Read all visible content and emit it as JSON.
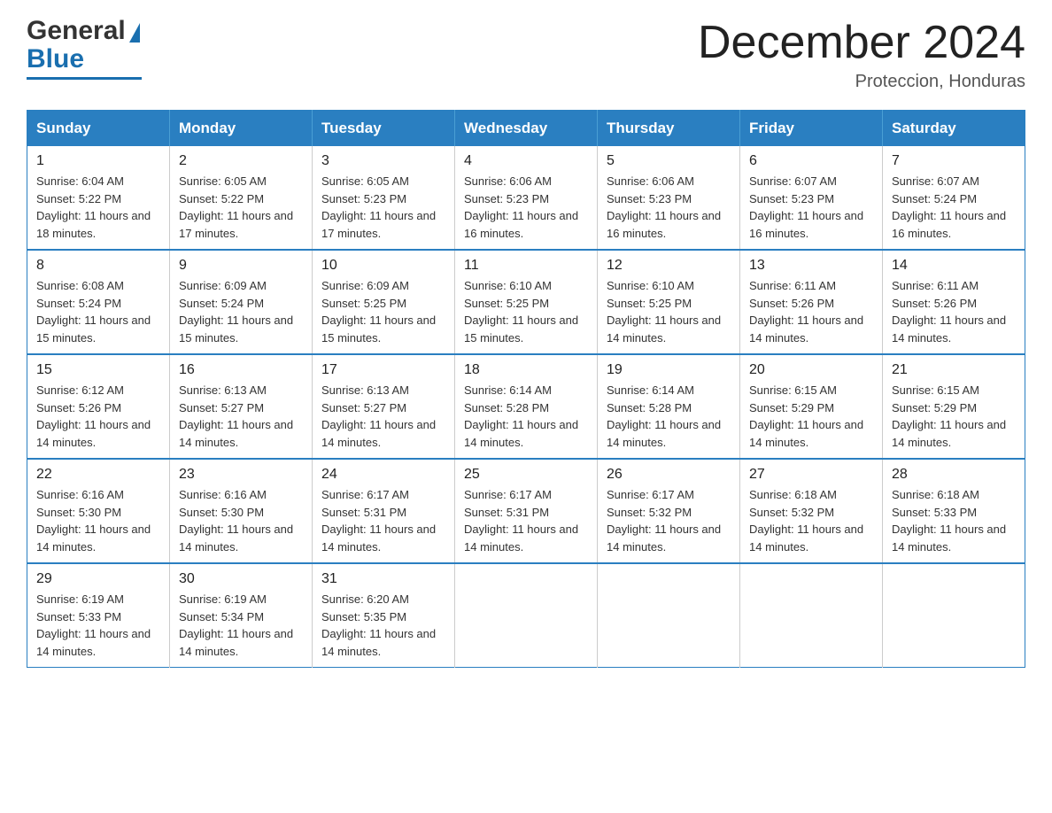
{
  "logo": {
    "general": "General",
    "blue": "Blue",
    "triangle": "▶"
  },
  "title": {
    "month_year": "December 2024",
    "location": "Proteccion, Honduras"
  },
  "weekdays": [
    "Sunday",
    "Monday",
    "Tuesday",
    "Wednesday",
    "Thursday",
    "Friday",
    "Saturday"
  ],
  "weeks": [
    [
      {
        "day": "1",
        "sunrise": "6:04 AM",
        "sunset": "5:22 PM",
        "daylight": "11 hours and 18 minutes."
      },
      {
        "day": "2",
        "sunrise": "6:05 AM",
        "sunset": "5:22 PM",
        "daylight": "11 hours and 17 minutes."
      },
      {
        "day": "3",
        "sunrise": "6:05 AM",
        "sunset": "5:23 PM",
        "daylight": "11 hours and 17 minutes."
      },
      {
        "day": "4",
        "sunrise": "6:06 AM",
        "sunset": "5:23 PM",
        "daylight": "11 hours and 16 minutes."
      },
      {
        "day": "5",
        "sunrise": "6:06 AM",
        "sunset": "5:23 PM",
        "daylight": "11 hours and 16 minutes."
      },
      {
        "day": "6",
        "sunrise": "6:07 AM",
        "sunset": "5:23 PM",
        "daylight": "11 hours and 16 minutes."
      },
      {
        "day": "7",
        "sunrise": "6:07 AM",
        "sunset": "5:24 PM",
        "daylight": "11 hours and 16 minutes."
      }
    ],
    [
      {
        "day": "8",
        "sunrise": "6:08 AM",
        "sunset": "5:24 PM",
        "daylight": "11 hours and 15 minutes."
      },
      {
        "day": "9",
        "sunrise": "6:09 AM",
        "sunset": "5:24 PM",
        "daylight": "11 hours and 15 minutes."
      },
      {
        "day": "10",
        "sunrise": "6:09 AM",
        "sunset": "5:25 PM",
        "daylight": "11 hours and 15 minutes."
      },
      {
        "day": "11",
        "sunrise": "6:10 AM",
        "sunset": "5:25 PM",
        "daylight": "11 hours and 15 minutes."
      },
      {
        "day": "12",
        "sunrise": "6:10 AM",
        "sunset": "5:25 PM",
        "daylight": "11 hours and 14 minutes."
      },
      {
        "day": "13",
        "sunrise": "6:11 AM",
        "sunset": "5:26 PM",
        "daylight": "11 hours and 14 minutes."
      },
      {
        "day": "14",
        "sunrise": "6:11 AM",
        "sunset": "5:26 PM",
        "daylight": "11 hours and 14 minutes."
      }
    ],
    [
      {
        "day": "15",
        "sunrise": "6:12 AM",
        "sunset": "5:26 PM",
        "daylight": "11 hours and 14 minutes."
      },
      {
        "day": "16",
        "sunrise": "6:13 AM",
        "sunset": "5:27 PM",
        "daylight": "11 hours and 14 minutes."
      },
      {
        "day": "17",
        "sunrise": "6:13 AM",
        "sunset": "5:27 PM",
        "daylight": "11 hours and 14 minutes."
      },
      {
        "day": "18",
        "sunrise": "6:14 AM",
        "sunset": "5:28 PM",
        "daylight": "11 hours and 14 minutes."
      },
      {
        "day": "19",
        "sunrise": "6:14 AM",
        "sunset": "5:28 PM",
        "daylight": "11 hours and 14 minutes."
      },
      {
        "day": "20",
        "sunrise": "6:15 AM",
        "sunset": "5:29 PM",
        "daylight": "11 hours and 14 minutes."
      },
      {
        "day": "21",
        "sunrise": "6:15 AM",
        "sunset": "5:29 PM",
        "daylight": "11 hours and 14 minutes."
      }
    ],
    [
      {
        "day": "22",
        "sunrise": "6:16 AM",
        "sunset": "5:30 PM",
        "daylight": "11 hours and 14 minutes."
      },
      {
        "day": "23",
        "sunrise": "6:16 AM",
        "sunset": "5:30 PM",
        "daylight": "11 hours and 14 minutes."
      },
      {
        "day": "24",
        "sunrise": "6:17 AM",
        "sunset": "5:31 PM",
        "daylight": "11 hours and 14 minutes."
      },
      {
        "day": "25",
        "sunrise": "6:17 AM",
        "sunset": "5:31 PM",
        "daylight": "11 hours and 14 minutes."
      },
      {
        "day": "26",
        "sunrise": "6:17 AM",
        "sunset": "5:32 PM",
        "daylight": "11 hours and 14 minutes."
      },
      {
        "day": "27",
        "sunrise": "6:18 AM",
        "sunset": "5:32 PM",
        "daylight": "11 hours and 14 minutes."
      },
      {
        "day": "28",
        "sunrise": "6:18 AM",
        "sunset": "5:33 PM",
        "daylight": "11 hours and 14 minutes."
      }
    ],
    [
      {
        "day": "29",
        "sunrise": "6:19 AM",
        "sunset": "5:33 PM",
        "daylight": "11 hours and 14 minutes."
      },
      {
        "day": "30",
        "sunrise": "6:19 AM",
        "sunset": "5:34 PM",
        "daylight": "11 hours and 14 minutes."
      },
      {
        "day": "31",
        "sunrise": "6:20 AM",
        "sunset": "5:35 PM",
        "daylight": "11 hours and 14 minutes."
      },
      null,
      null,
      null,
      null
    ]
  ],
  "labels": {
    "sunrise_prefix": "Sunrise: ",
    "sunset_prefix": "Sunset: ",
    "daylight_prefix": "Daylight: "
  }
}
